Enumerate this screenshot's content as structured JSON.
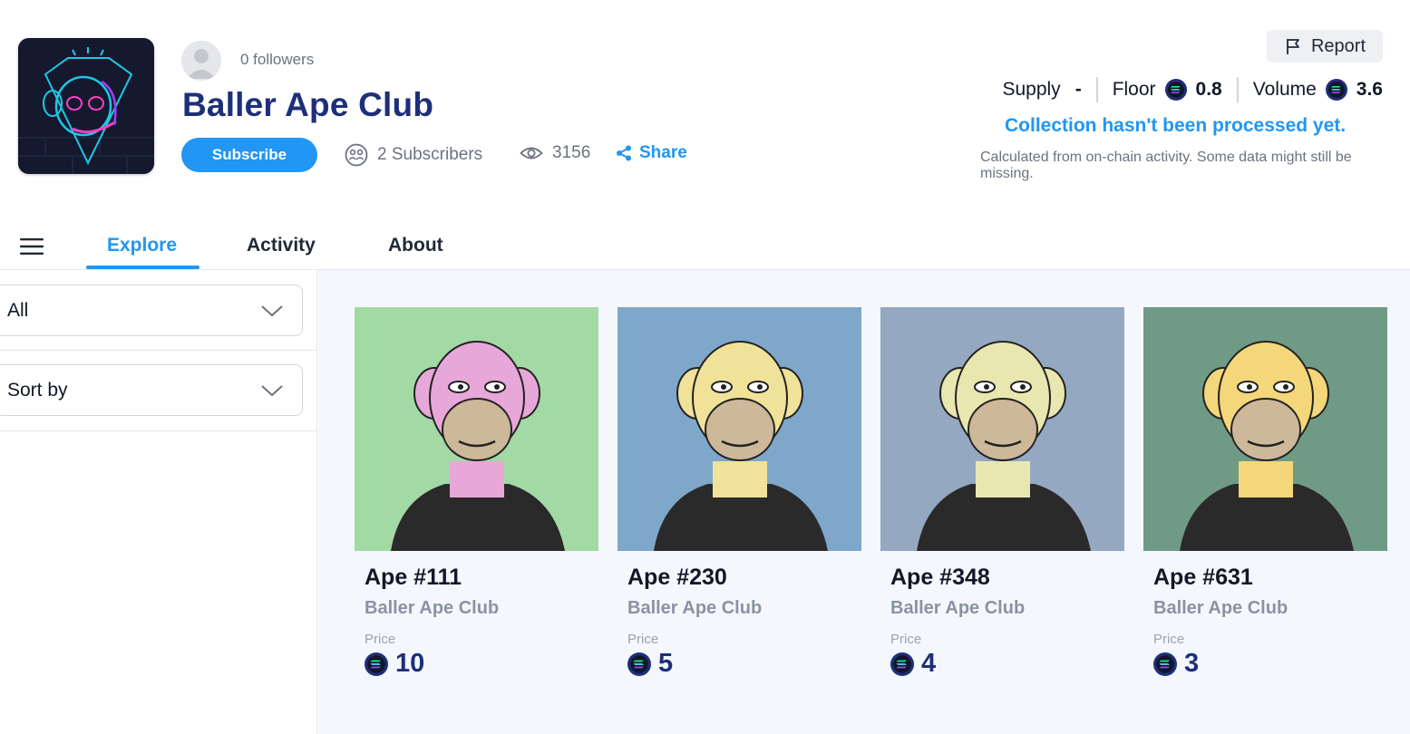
{
  "collection": {
    "title": "Baller Ape Club",
    "followers_text": "0 followers",
    "subscribe_label": "Subscribe",
    "subscribers_text": "2 Subscribers",
    "views": "3156",
    "share_label": "Share",
    "report_label": "Report"
  },
  "stats": {
    "supply_label": "Supply",
    "supply_value": "-",
    "floor_label": "Floor",
    "floor_value": "0.8",
    "volume_label": "Volume",
    "volume_value": "3.6",
    "processed_text": "Collection hasn't been processed yet.",
    "note_text": "Calculated from on-chain activity. Some data might still be missing."
  },
  "tabs": [
    {
      "label": "Explore",
      "active": true
    },
    {
      "label": "Activity",
      "active": false
    },
    {
      "label": "About",
      "active": false
    }
  ],
  "filters": {
    "category_value": "All",
    "sort_placeholder": "Sort by"
  },
  "cards": [
    {
      "name": "Ape #111",
      "collection": "Baller Ape Club",
      "price_label": "Price",
      "price": "10",
      "bg": "#a3d9a5",
      "fur": "#e7a7d8"
    },
    {
      "name": "Ape #230",
      "collection": "Baller Ape Club",
      "price_label": "Price",
      "price": "5",
      "bg": "#7fa7c9",
      "fur": "#f1e29a"
    },
    {
      "name": "Ape #348",
      "collection": "Baller Ape Club",
      "price_label": "Price",
      "price": "4",
      "bg": "#95a8c2",
      "fur": "#e9e7b0"
    },
    {
      "name": "Ape #631",
      "collection": "Baller Ape Club",
      "price_label": "Price",
      "price": "3",
      "bg": "#6f9a86",
      "fur": "#f4d77a"
    }
  ],
  "icons": {
    "report": "flag-icon",
    "subscribers": "people-icon",
    "views": "eye-icon",
    "share": "share-icon",
    "menu": "hamburger-icon",
    "dropdown": "chevron-down-icon",
    "currency": "solana-token-icon"
  },
  "colors": {
    "accent": "#2196f3",
    "title": "#1e2f7a"
  }
}
